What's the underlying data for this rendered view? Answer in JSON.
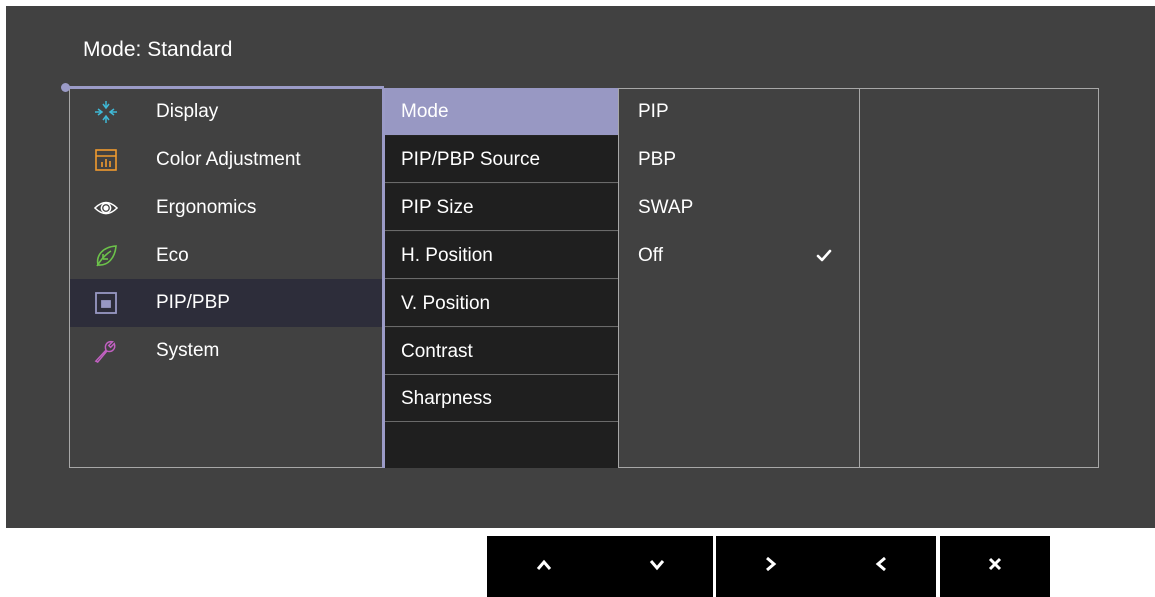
{
  "header": {
    "mode_title": "Mode: Standard"
  },
  "categories": [
    {
      "label": "Display",
      "icon": "display-icon",
      "color": "#3fb9d6"
    },
    {
      "label": "Color Adjustment",
      "icon": "color-adjustment-icon",
      "color": "#f09a2e"
    },
    {
      "label": "Ergonomics",
      "icon": "eye-icon",
      "color": "#ffffff"
    },
    {
      "label": "Eco",
      "icon": "leaf-icon",
      "color": "#6cc24a"
    },
    {
      "label": "PIP/PBP",
      "icon": "pip-icon",
      "color": "#9898c3",
      "selected": true
    },
    {
      "label": "System",
      "icon": "wrench-icon",
      "color": "#c060c0"
    }
  ],
  "options": [
    {
      "label": "Mode",
      "selected": true
    },
    {
      "label": "PIP/PBP Source"
    },
    {
      "label": "PIP Size"
    },
    {
      "label": "H. Position"
    },
    {
      "label": "V. Position"
    },
    {
      "label": "Contrast"
    },
    {
      "label": "Sharpness"
    },
    {
      "label": ""
    }
  ],
  "values": [
    {
      "label": "PIP"
    },
    {
      "label": "PBP"
    },
    {
      "label": "SWAP"
    },
    {
      "label": "Off",
      "checked": true
    }
  ],
  "buttons": [
    {
      "name": "up-button",
      "icon": "chevron-up-icon"
    },
    {
      "name": "down-button",
      "icon": "chevron-down-icon"
    },
    {
      "name": "enter-button",
      "icon": "chevron-right-icon"
    },
    {
      "name": "back-button",
      "icon": "chevron-left-icon"
    },
    {
      "name": "exit-button",
      "icon": "close-icon"
    }
  ],
  "colors": {
    "osd_background": "#414141",
    "selection_accent": "#9898c3",
    "option_background": "#1f1f1f",
    "button_background": "#000000"
  }
}
